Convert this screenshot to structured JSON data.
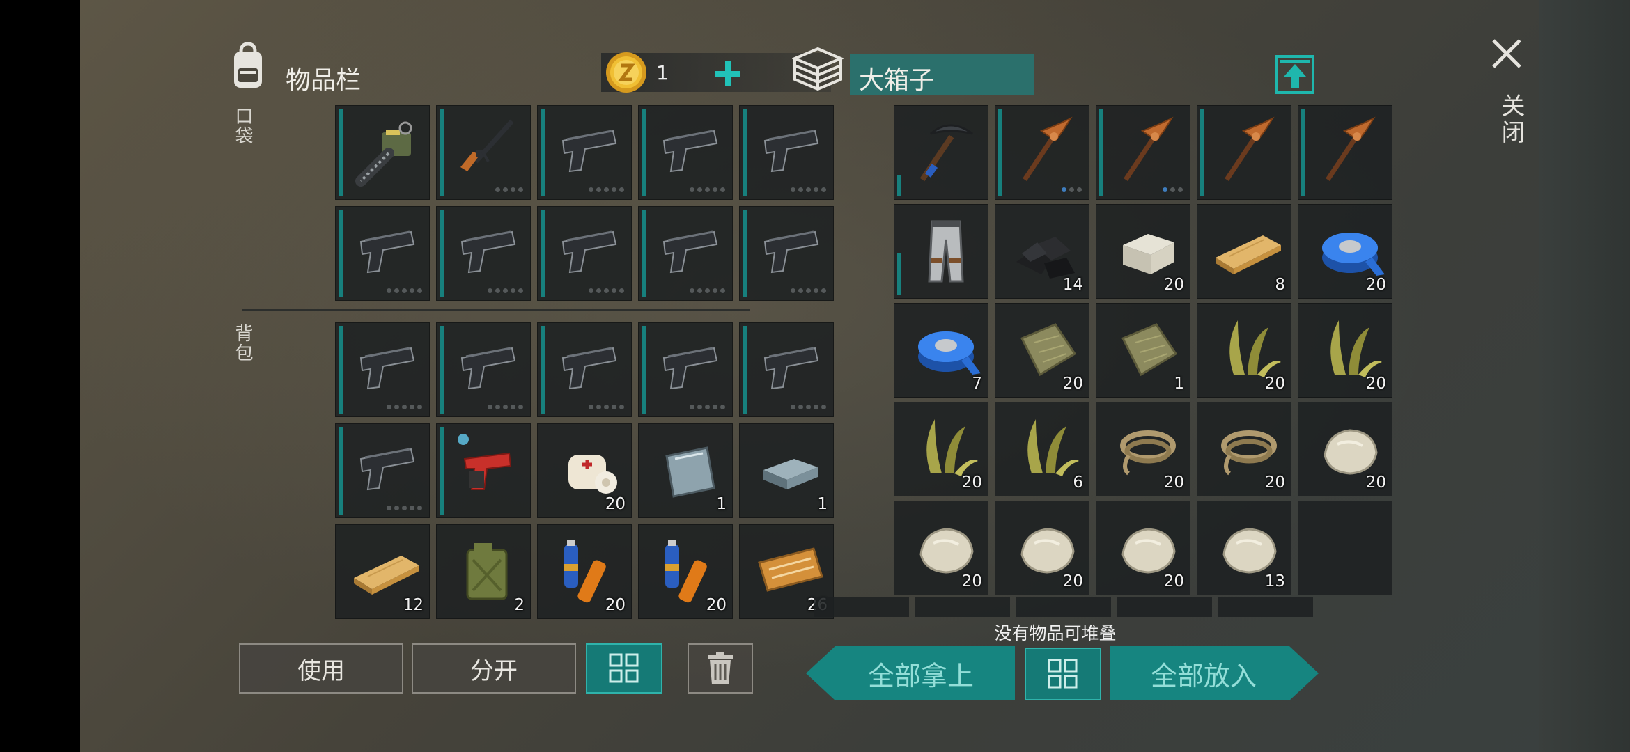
{
  "inventory": {
    "title": "物品栏",
    "coin_count": "1",
    "pocket_label": "口袋",
    "backpack_label": "背包",
    "pockets": [
      {
        "item": "chainsaw-icon"
      },
      {
        "item": "rifle-icon",
        "dots": 4,
        "dots_on": 0
      },
      {
        "item": "pistol-icon",
        "dots": 5,
        "dots_on": 0
      },
      {
        "item": "pistol-icon",
        "dots": 5,
        "dots_on": 0
      },
      {
        "item": "pistol-icon",
        "dots": 5,
        "dots_on": 0
      },
      {
        "item": "pistol-icon",
        "dots": 5,
        "dots_on": 0
      },
      {
        "item": "pistol-icon",
        "dots": 5,
        "dots_on": 0
      },
      {
        "item": "pistol-icon",
        "dots": 5,
        "dots_on": 0
      },
      {
        "item": "pistol-icon",
        "dots": 5,
        "dots_on": 0
      },
      {
        "item": "pistol-icon",
        "dots": 5,
        "dots_on": 0
      }
    ],
    "backpack": [
      {
        "item": "pistol-icon",
        "dots": 5,
        "dots_on": 0
      },
      {
        "item": "pistol-icon",
        "dots": 5,
        "dots_on": 0
      },
      {
        "item": "pistol-icon",
        "dots": 5,
        "dots_on": 0
      },
      {
        "item": "pistol-icon",
        "dots": 5,
        "dots_on": 0
      },
      {
        "item": "pistol-icon",
        "dots": 5,
        "dots_on": 0
      },
      {
        "item": "pistol-icon",
        "dots": 5,
        "dots_on": 0
      },
      {
        "item": "flare-gun-icon"
      },
      {
        "item": "bandage-icon",
        "count": "20"
      },
      {
        "item": "metal-plate-icon",
        "count": "1"
      },
      {
        "item": "iron-ingot-icon",
        "count": "1"
      },
      {
        "item": "plank-icon",
        "count": "12"
      },
      {
        "item": "jerrycan-icon",
        "count": "2"
      },
      {
        "item": "batteries-icon",
        "count": "20"
      },
      {
        "item": "batteries-icon",
        "count": "20"
      },
      {
        "item": "coupon-icon",
        "count": "26"
      }
    ]
  },
  "chest": {
    "title": "大箱子",
    "items": [
      {
        "item": "pickaxe-icon",
        "bar": "short"
      },
      {
        "item": "copper-pickaxe-icon",
        "dots": 3,
        "dots_on": 1
      },
      {
        "item": "copper-pickaxe-icon",
        "dots": 3,
        "dots_on": 1
      },
      {
        "item": "copper-pickaxe-icon"
      },
      {
        "item": "copper-pickaxe-icon"
      },
      {
        "item": "pants-icon",
        "bar": "mid"
      },
      {
        "item": "coal-icon",
        "count": "14"
      },
      {
        "item": "stone-block-icon",
        "count": "20"
      },
      {
        "item": "plank-icon",
        "count": "8"
      },
      {
        "item": "tape-icon",
        "count": "20"
      },
      {
        "item": "tape-icon",
        "count": "7"
      },
      {
        "item": "cloth-icon",
        "count": "20"
      },
      {
        "item": "cloth-icon",
        "count": "1"
      },
      {
        "item": "plant-fiber-icon",
        "count": "20"
      },
      {
        "item": "plant-fiber-icon",
        "count": "20"
      },
      {
        "item": "plant-fiber-icon",
        "count": "20"
      },
      {
        "item": "plant-fiber-icon",
        "count": "6"
      },
      {
        "item": "rope-icon",
        "count": "20"
      },
      {
        "item": "rope-icon",
        "count": "20"
      },
      {
        "item": "rock-icon",
        "count": "20"
      },
      {
        "item": "rock-icon",
        "count": "20"
      },
      {
        "item": "rock-icon",
        "count": "20"
      },
      {
        "item": "rock-icon",
        "count": "20"
      },
      {
        "item": "rock-icon",
        "count": "13"
      },
      {
        "item": "empty"
      }
    ],
    "status_text": "没有物品可堆叠"
  },
  "buttons": {
    "use": "使用",
    "split": "分开",
    "take_all": "全部拿上",
    "put_all": "全部放入",
    "close": "关闭"
  },
  "colors": {
    "accent": "#157a76",
    "bar": "#17807d",
    "slot": "#1e2122"
  }
}
